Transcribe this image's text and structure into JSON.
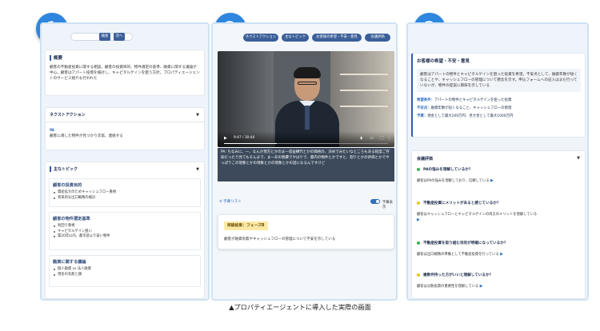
{
  "badges": [
    "1",
    "2",
    "3"
  ],
  "panel1": {
    "search_placeholder": "",
    "search_btn": "検索",
    "next_btn": "次へ",
    "summary_title": "概要",
    "summary_text": "顧客の不動産投資に関する相談。顧客の投資目的、物件選定の基準、融資に関する議論が中心。顧客はアパート投資を検討し、キャピタルゲインを狙う方針。プロパティエージェントのサービス紹介も行われた",
    "next_action_title": "ネクストアクション",
    "next_action_role": "PA",
    "next_action_text": "顧客に適した物件が見つかり次第、連絡する",
    "topics_title": "主なトピック",
    "topics": [
      {
        "title": "顧客の投資目的",
        "items": [
          "資産拡大のためキャッシュフロー重視",
          "将来的な出口戦略の検討"
        ]
      },
      {
        "title": "顧客の物件選定基準",
        "items": [
          "利回り重視",
          "キャピタルゲイン狙い",
          "築20年以内、都市部より安い物件"
        ]
      },
      {
        "title": "融資に関する議論",
        "items": [
          "個人融資 vs 法人融資",
          "現金の有無と額"
        ]
      }
    ]
  },
  "panel2": {
    "tabs": [
      "ネクストアクション",
      "主なトピック",
      "お客様の希望・不安・意見",
      "会議評価"
    ],
    "video_time": "9:47 / 30:44",
    "video_progress": 0.32,
    "transcript": "PA: ちなみに、一、なんか現方とかのま一収益構代とかの価格の、決めでみたいなところもある程度ご存知だったり見てもそんまで、ま一あの税費でやはりで、都内の物件とかですと、割りとかの評価とかでやっぱりこの現象とかの現象とかの現象とかの話になるんですけど",
    "subtitle_list_label": "字幕リスト",
    "subtitle_toggle_label": "字幕表示",
    "phase_label": "商談結果：フェーズB",
    "phase_text": "顧客が融資有無やキャッシュフローの管理について不安を示している"
  },
  "panel3": {
    "wish_title": "お客様の希望・不安・意見",
    "wish_text": "顧客はアパートの物件とキャピタルゲインを狙った投資を希望。不安点として、融資年数が短くなることや、キャッシュフローの管理について懸念を示す。申込フォームへの記入はまだ行っていないが、物件の提案に興味を示している",
    "details": [
      {
        "label": "希望条件：",
        "value": "アパートの物件とキャピタルゲインを狙った投資"
      },
      {
        "label": "不安点：",
        "value": "融資年数が短くなること、キャッシュフローの管理"
      },
      {
        "label": "予算：",
        "value": "現金として最大200万円、見せ金として最大1000万円"
      }
    ],
    "eval_title": "会議評価",
    "questions": [
      {
        "q": "PAの強みを理解しているか？",
        "a": "顧客はPAの強みを理解しており、信頼している",
        "color": "#3fb34f"
      },
      {
        "q": "不動産投資にメリットがあると感じているか？",
        "a": "顧客はキャッシュフローとキャピタルゲインの両方のメリットを理解している",
        "color": "#f0c419"
      },
      {
        "q": "不動産投資を取り組む目的が明確になっているか？",
        "a": "顧客は出口戦略の準備として不動産投資を行っている",
        "color": "#3fb34f"
      },
      {
        "q": "複数件持った方がいいと理解しているか？",
        "a": "顧客は分散投資の重要性を理解している",
        "color": "#f0c419"
      }
    ]
  },
  "caption": "▲プロパティエージェントに導入した実際の画面"
}
